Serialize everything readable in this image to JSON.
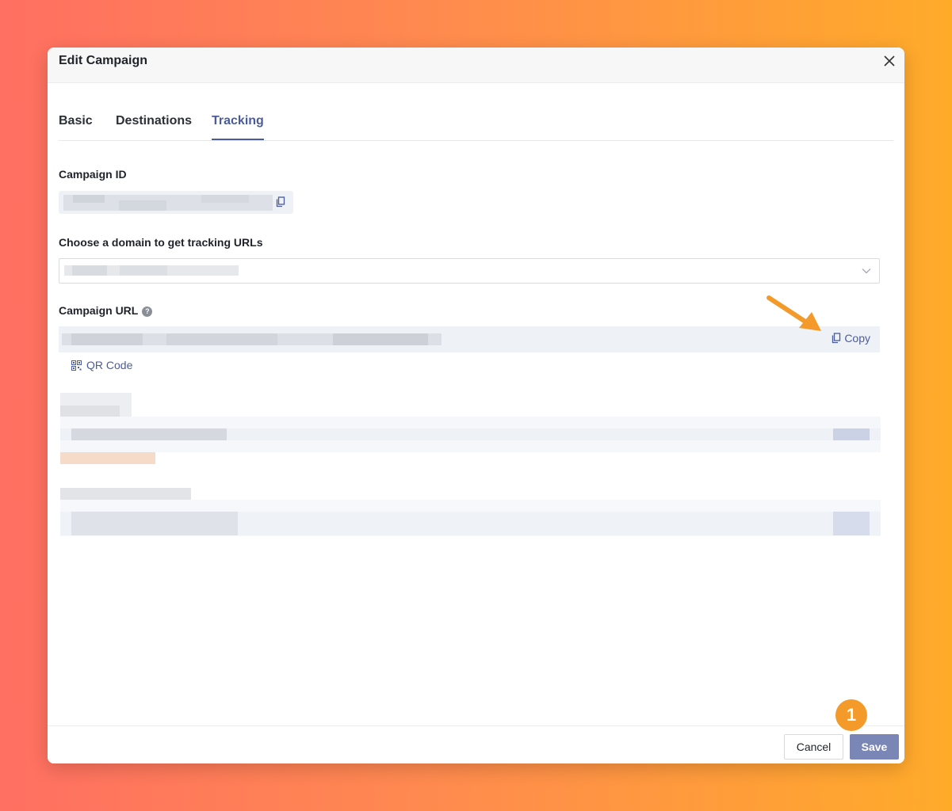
{
  "dialog": {
    "title": "Edit Campaign",
    "tabs": [
      {
        "label": "Basic"
      },
      {
        "label": "Destinations"
      },
      {
        "label": "Tracking"
      }
    ],
    "active_tab": "Tracking"
  },
  "fields": {
    "campaign_id_label": "Campaign ID",
    "domain_label": "Choose a domain to get tracking URLs",
    "campaign_url_label": "Campaign URL",
    "copy_label": "Copy",
    "qr_code_label": "QR Code"
  },
  "footer": {
    "cancel_label": "Cancel",
    "save_label": "Save"
  },
  "annotation": {
    "step_number": "1"
  },
  "colors": {
    "accent": "#4b5c9c",
    "save_button": "#7a86b5",
    "badge": "#f39a2a",
    "arrow": "#f39a2a"
  },
  "icons": [
    "close-icon",
    "copy-icon",
    "help-icon",
    "chevron-down-icon",
    "qr-code-icon"
  ]
}
